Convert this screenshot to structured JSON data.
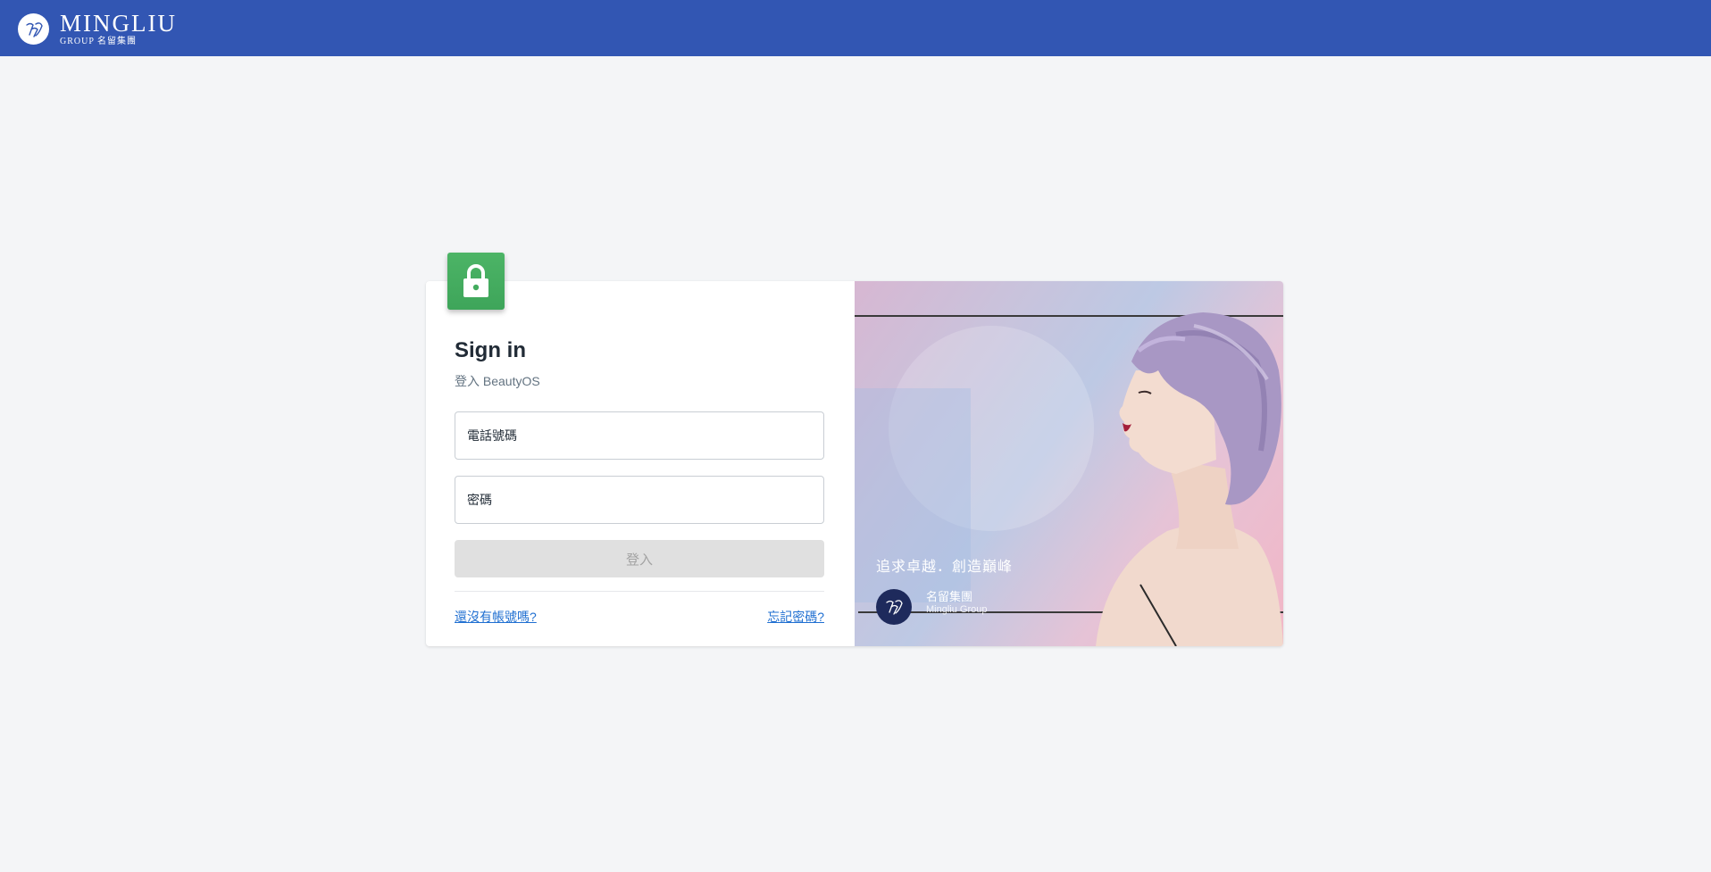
{
  "header": {
    "brand_name": "MINGLIU",
    "brand_sub": "GROUP 名留集團",
    "logo_icon": "mingliu-monogram-logo"
  },
  "colors": {
    "header_bg": "#3256b3",
    "page_bg": "#f4f5f7",
    "lock_badge": "#43ac5e",
    "link": "#1f6fd1",
    "button_disabled_bg": "#e0e0e0"
  },
  "login": {
    "title": "Sign in",
    "subtitle": "登入 BeautyOS",
    "phone_placeholder": "電話號碼",
    "password_placeholder": "密碼",
    "submit_label": "登入",
    "register_link": "還沒有帳號嗎?",
    "forgot_link": "忘記密碼?",
    "lock_icon": "lock-icon"
  },
  "promo": {
    "tagline": "追求卓越．創造巔峰",
    "company_cn": "名留集團",
    "company_en": "Mingliu Group"
  }
}
